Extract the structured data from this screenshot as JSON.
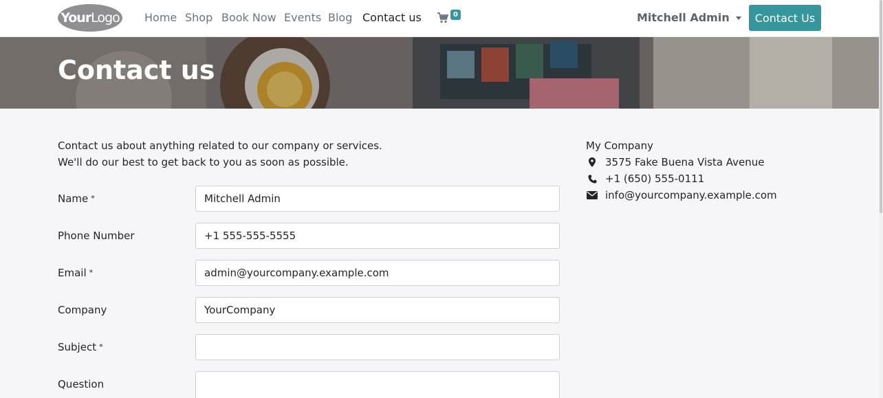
{
  "header": {
    "logo": {
      "part1": "Your",
      "part2": "Logo"
    },
    "nav": [
      {
        "label": "Home"
      },
      {
        "label": "Shop"
      },
      {
        "label": "Book Now"
      },
      {
        "label": "Events"
      },
      {
        "label": "Blog"
      },
      {
        "label": "Contact us",
        "active": true
      }
    ],
    "cart_count": "0",
    "user_name": "Mitchell Admin",
    "cta_label": "Contact Us"
  },
  "banner": {
    "title": "Contact us"
  },
  "intro": {
    "line1": "Contact us about anything related to our company or services.",
    "line2": "We'll do our best to get back to you as soon as possible."
  },
  "form": {
    "name": {
      "label": "Name",
      "required": "*",
      "value": "Mitchell Admin"
    },
    "phone": {
      "label": "Phone Number",
      "value": "+1 555-555-5555"
    },
    "email": {
      "label": "Email",
      "required": "*",
      "value": "admin@yourcompany.example.com"
    },
    "company": {
      "label": "Company",
      "value": "YourCompany"
    },
    "subject": {
      "label": "Subject",
      "required": "*",
      "value": ""
    },
    "question": {
      "label": "Question",
      "value": ""
    }
  },
  "company_info": {
    "name": "My Company",
    "address": "3575 Fake Buena Vista Avenue",
    "phone": "+1 (650) 555-0111",
    "email": "info@yourcompany.example.com",
    "icons": {
      "address": "map-marker-icon",
      "phone": "phone-icon",
      "email": "envelope-icon"
    }
  },
  "colors": {
    "accent": "#35979c",
    "background": "#f6f6f8",
    "nav_text": "#6c757d"
  }
}
